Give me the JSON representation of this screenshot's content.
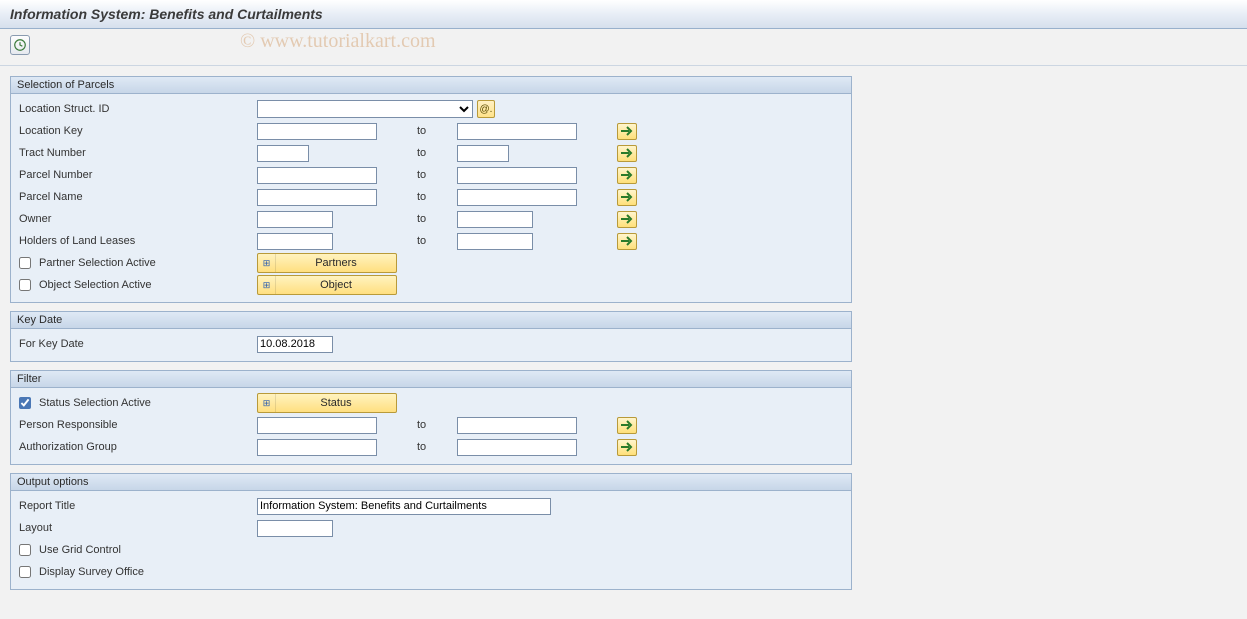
{
  "title": "Information System: Benefits and Curtailments",
  "watermark": "© www.tutorialkart.com",
  "groups": {
    "parcels": {
      "title": "Selection of Parcels",
      "locationStructId": {
        "label": "Location Struct. ID",
        "value": ""
      },
      "locationKey": {
        "label": "Location Key",
        "from": "",
        "to": ""
      },
      "tractNumber": {
        "label": "Tract Number",
        "from": "",
        "to": ""
      },
      "parcelNumber": {
        "label": "Parcel Number",
        "from": "",
        "to": ""
      },
      "parcelName": {
        "label": "Parcel Name",
        "from": "",
        "to": ""
      },
      "owner": {
        "label": "Owner",
        "from": "",
        "to": ""
      },
      "holders": {
        "label": "Holders of Land Leases",
        "from": "",
        "to": ""
      },
      "partnerSelection": {
        "label": "Partner Selection Active",
        "checked": false,
        "button": "Partners"
      },
      "objectSelection": {
        "label": "Object Selection Active",
        "checked": false,
        "button": "Object"
      },
      "toLabel": "to"
    },
    "keyDate": {
      "title": "Key Date",
      "forKeyDate": {
        "label": "For Key Date",
        "value": "10.08.2018"
      }
    },
    "filter": {
      "title": "Filter",
      "statusSelection": {
        "label": "Status Selection Active",
        "checked": true,
        "button": "Status"
      },
      "personResponsible": {
        "label": "Person Responsible",
        "from": "",
        "to": ""
      },
      "authGroup": {
        "label": "Authorization Group",
        "from": "",
        "to": ""
      },
      "toLabel": "to"
    },
    "output": {
      "title": "Output options",
      "reportTitle": {
        "label": "Report Title",
        "value": "Information System: Benefits and Curtailments"
      },
      "layout": {
        "label": "Layout",
        "value": ""
      },
      "useGrid": {
        "label": "Use Grid Control",
        "checked": false
      },
      "displaySurvey": {
        "label": "Display Survey Office",
        "checked": false
      }
    }
  }
}
